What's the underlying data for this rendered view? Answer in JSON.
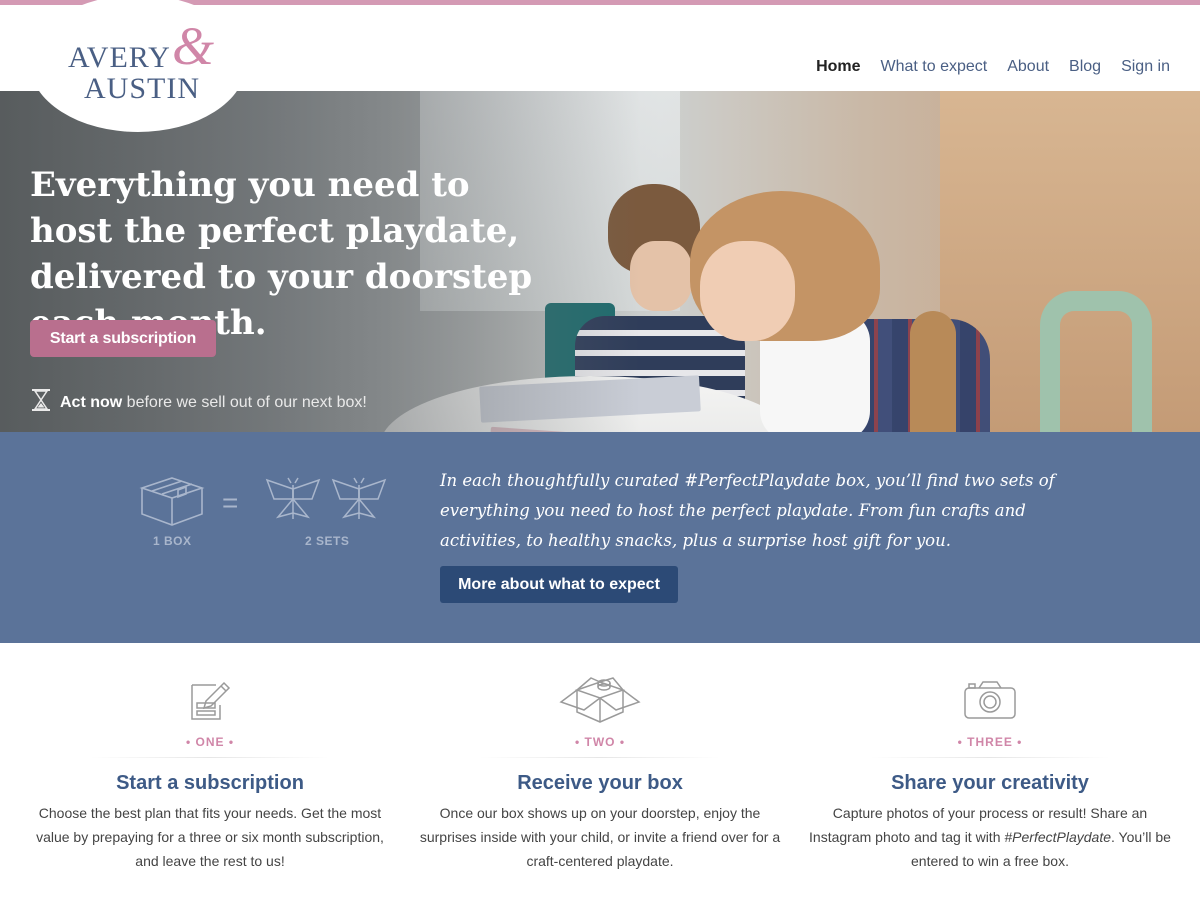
{
  "brand": {
    "line1": "AVERY",
    "amp": "&",
    "line2": "AUSTIN"
  },
  "nav": {
    "items": [
      {
        "label": "Home",
        "active": true
      },
      {
        "label": "What to expect"
      },
      {
        "label": "About"
      },
      {
        "label": "Blog"
      },
      {
        "label": "Sign in"
      }
    ]
  },
  "hero": {
    "headline": "Everything you need to host the perfect playdate, delivered to your doorstep each month.",
    "cta_label": "Start a subscription",
    "notice_strong": "Act now",
    "notice_rest": "before we sell out of our next box!",
    "notice_icon": "hourglass-icon"
  },
  "expect": {
    "box_label": "1 BOX",
    "equals": "=",
    "sets_label": "2 SETS",
    "description": "In each thoughtfully curated #PerfectPlaydate box, you’ll find two sets of everything you need to host the perfect playdate. From fun crafts and activities, to healthy snacks, plus a surprise host gift for you.",
    "button_label": "More about what to expect"
  },
  "steps": [
    {
      "number": "• ONE •",
      "icon": "form-pencil-icon",
      "title": "Start a subscription",
      "text": "Choose the best plan that fits your needs. Get the most value by prepaying for a three or six month subscription, and leave the rest to us!"
    },
    {
      "number": "• TWO •",
      "icon": "open-box-icon",
      "title": "Receive your box",
      "text": "Once our box shows up on your doorstep, enjoy the surprises inside with your child, or invite a friend over for a craft-centered playdate."
    },
    {
      "number": "• THREE •",
      "icon": "camera-icon",
      "title": "Share your creativity",
      "text_before": "Capture photos of your process or result! Share an Instagram photo and tag it with ",
      "text_tag": "#PerfectPlaydate",
      "text_after": ". You’ll be entered to win a free box."
    }
  ],
  "colors": {
    "accent_pink": "#b96f8e",
    "brand_blue": "#4a5f84",
    "band_blue": "#5b7399",
    "button_dark_blue": "#2c4a76"
  }
}
